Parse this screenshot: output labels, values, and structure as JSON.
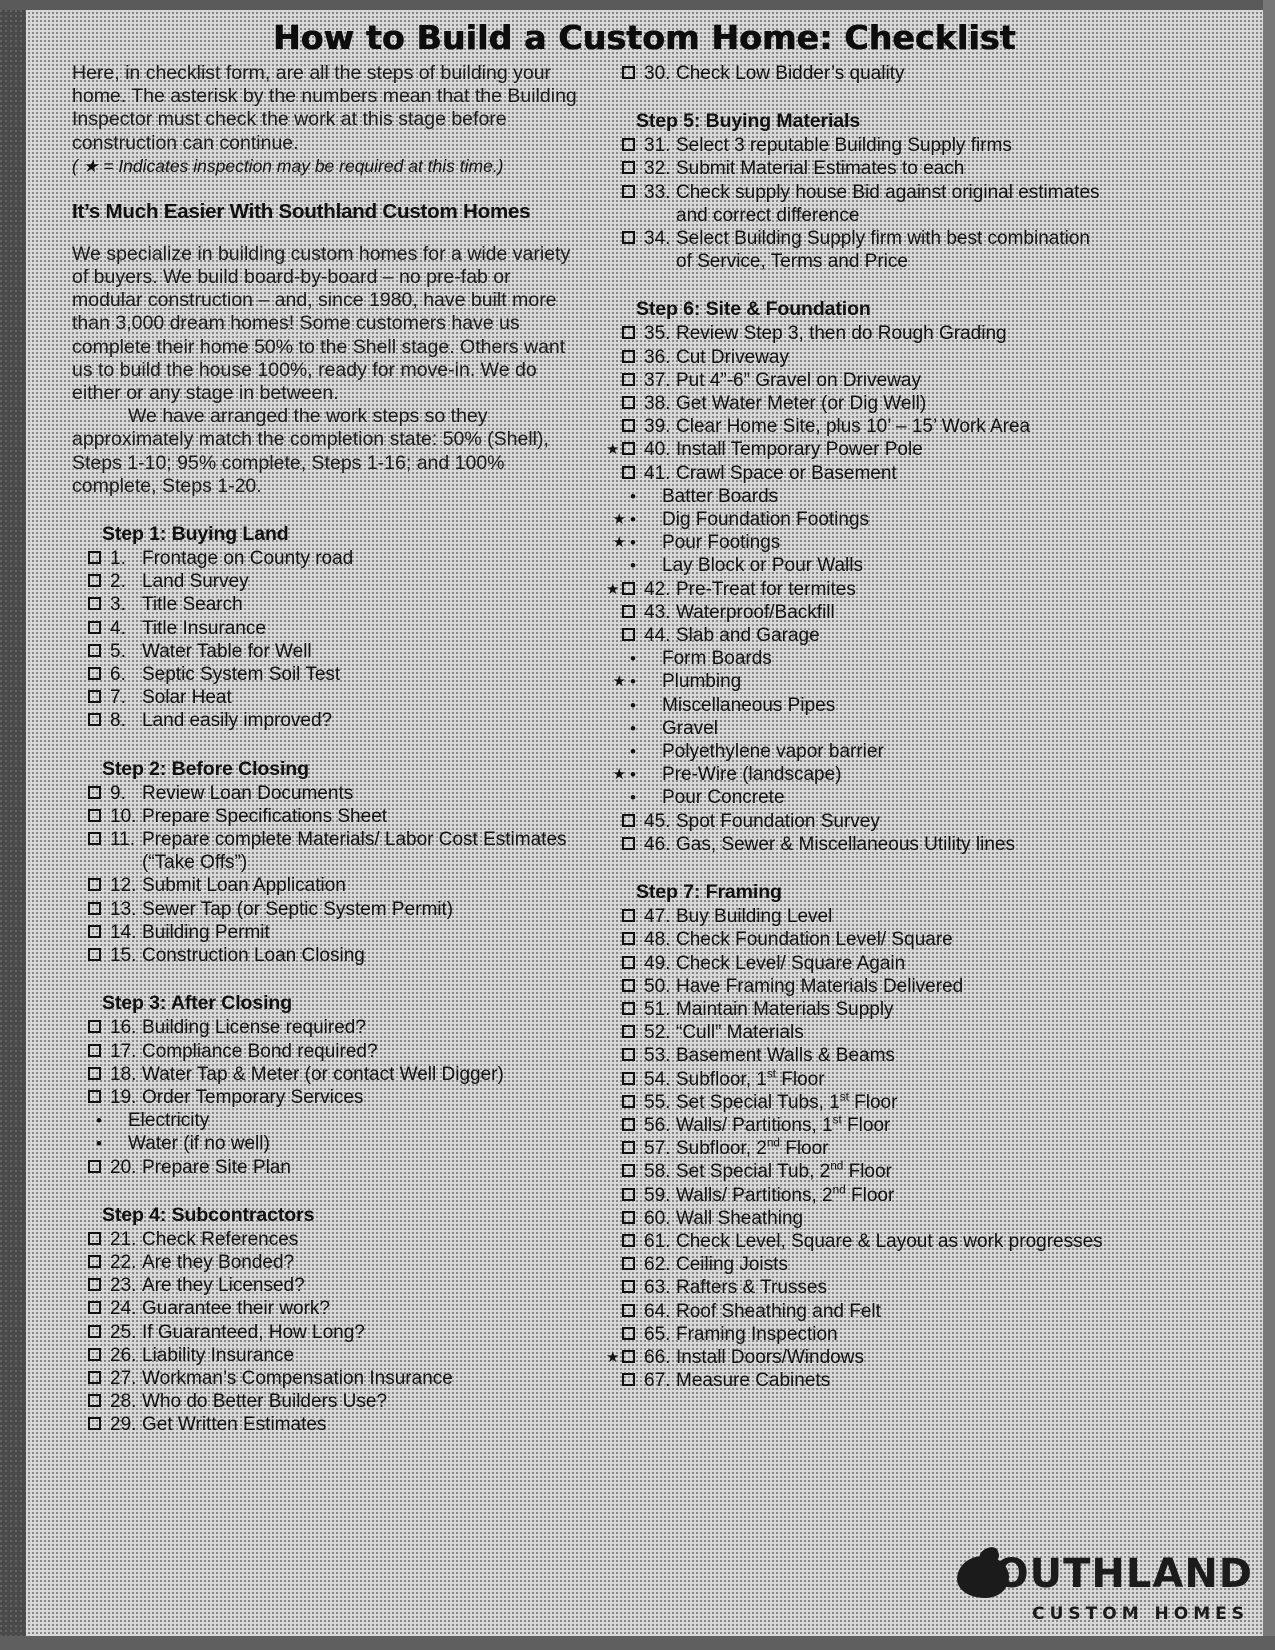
{
  "document": {
    "title": "How to Build a Custom Home: Checklist"
  },
  "intro": {
    "paragraph": "Here, in checklist form, are all the steps of building your home. The asterisk by the numbers mean that the Building Inspector must check the work at this stage before construction can continue.",
    "note": "( ★ = Indicates inspection may be required at this time.)",
    "heading": "It’s Much Easier With Southland Custom Homes",
    "body1": "We specialize in building custom homes for a wide variety of buyers. We build board-by-board – no pre-fab or modular construction – and, since 1980, have built more than 3,000 dream homes! Some customers have us complete their home 50% to the Shell stage. Others want us to build the house 100%, ready for move-in. We do either or any stage in between.",
    "body2": "We have arranged the work steps so they approximately match the completion state: 50% (Shell), Steps 1-10; 95% complete, Steps 1-16; and 100% complete, Steps 1-20."
  },
  "steps": [
    {
      "heading": "Step 1: Buying Land",
      "items": [
        {
          "num": "1.",
          "text": "Frontage on County road"
        },
        {
          "num": "2.",
          "text": "Land Survey"
        },
        {
          "num": "3.",
          "text": "Title Search"
        },
        {
          "num": "4.",
          "text": "Title Insurance"
        },
        {
          "num": "5.",
          "text": "Water Table for Well"
        },
        {
          "num": "6.",
          "text": "Septic System Soil Test"
        },
        {
          "num": "7.",
          "text": "Solar Heat"
        },
        {
          "num": "8.",
          "text": "Land easily improved?"
        }
      ]
    },
    {
      "heading": "Step 2: Before Closing",
      "items": [
        {
          "num": "9.",
          "text": "Review Loan Documents"
        },
        {
          "num": "10.",
          "text": "Prepare Specifications Sheet"
        },
        {
          "num": "11.",
          "text": "Prepare complete Materials/ Labor Cost Estimates",
          "cont": "(“Take Offs”)"
        },
        {
          "num": "12.",
          "text": "Submit Loan Application"
        },
        {
          "num": "13.",
          "text": "Sewer Tap (or Septic System Permit)"
        },
        {
          "num": "14.",
          "text": "Building Permit"
        },
        {
          "num": "15.",
          "text": "Construction Loan Closing"
        }
      ]
    },
    {
      "heading": "Step 3: After Closing",
      "items": [
        {
          "num": "16.",
          "text": "Building License required?"
        },
        {
          "num": "17.",
          "text": "Compliance Bond required?"
        },
        {
          "num": "18.",
          "text": "Water Tap & Meter (or contact Well Digger)"
        },
        {
          "num": "19.",
          "text": "Order Temporary Services",
          "subs": [
            {
              "text": "Electricity"
            },
            {
              "text": "Water (if no well)"
            }
          ]
        },
        {
          "num": "20.",
          "text": "Prepare Site Plan"
        }
      ]
    },
    {
      "heading": "Step 4: Subcontractors",
      "items": [
        {
          "num": "21.",
          "text": "Check References"
        },
        {
          "num": "22.",
          "text": "Are they Bonded?"
        },
        {
          "num": "23.",
          "text": "Are they Licensed?"
        },
        {
          "num": "24.",
          "text": "Guarantee their work?"
        },
        {
          "num": "25.",
          "text": "If Guaranteed, How Long?"
        },
        {
          "num": "26.",
          "text": "Liability Insurance"
        },
        {
          "num": "27.",
          "text": "Workman’s Compensation Insurance"
        },
        {
          "num": "28.",
          "text": "Who do Better Builders Use?"
        },
        {
          "num": "29.",
          "text": "Get Written Estimates"
        },
        {
          "num": "30.",
          "text": "Check Low Bidder’s quality",
          "column": "right"
        }
      ]
    },
    {
      "heading": "Step 5: Buying Materials",
      "items": [
        {
          "num": "31.",
          "text": "Select 3 reputable Building Supply firms"
        },
        {
          "num": "32.",
          "text": "Submit Material Estimates to each"
        },
        {
          "num": "33.",
          "text": "Check supply house Bid against original estimates",
          "cont": "and correct difference"
        },
        {
          "num": "34.",
          "text": "Select Building Supply firm with best combination",
          "cont": "of Service, Terms and Price"
        }
      ]
    },
    {
      "heading": "Step 6: Site & Foundation",
      "items": [
        {
          "num": "35.",
          "text": "Review Step 3, then do Rough Grading"
        },
        {
          "num": "36.",
          "text": "Cut Driveway"
        },
        {
          "num": "37.",
          "text": "Put 4”-6” Gravel on Driveway"
        },
        {
          "num": "38.",
          "text": "Get Water Meter (or Dig Well)"
        },
        {
          "num": "39.",
          "text": "Clear Home Site, plus 10’ – 15’ Work Area"
        },
        {
          "num": "40.",
          "text": "Install Temporary Power Pole",
          "star": true
        },
        {
          "num": "41.",
          "text": "Crawl Space or Basement",
          "subs": [
            {
              "text": "Batter Boards"
            },
            {
              "text": "Dig Foundation Footings",
              "star": true
            },
            {
              "text": "Pour Footings",
              "star": true
            },
            {
              "text": "Lay Block or Pour Walls"
            }
          ]
        },
        {
          "num": "42.",
          "text": "Pre-Treat for termites",
          "star": true
        },
        {
          "num": "43.",
          "text": "Waterproof/Backfill"
        },
        {
          "num": "44.",
          "text": "Slab and Garage",
          "subs": [
            {
              "text": "Form Boards"
            },
            {
              "text": "Plumbing",
              "star": true
            },
            {
              "text": "Miscellaneous Pipes"
            },
            {
              "text": "Gravel"
            },
            {
              "text": "Polyethylene vapor barrier"
            },
            {
              "text": "Pre-Wire (landscape)",
              "star": true
            },
            {
              "text": "Pour Concrete"
            }
          ]
        },
        {
          "num": "45.",
          "text": "Spot Foundation Survey"
        },
        {
          "num": "46.",
          "text": "Gas, Sewer & Miscellaneous Utility lines"
        }
      ]
    },
    {
      "heading": "Step 7: Framing",
      "items": [
        {
          "num": "47.",
          "text": "Buy Building Level"
        },
        {
          "num": "48.",
          "text": "Check Foundation Level/ Square"
        },
        {
          "num": "49.",
          "text": "Check Level/ Square Again"
        },
        {
          "num": "50.",
          "text": "Have Framing Materials Delivered"
        },
        {
          "num": "51.",
          "text": "Maintain Materials Supply"
        },
        {
          "num": "52.",
          "text": "“Cull” Materials"
        },
        {
          "num": "53.",
          "text": "Basement Walls & Beams"
        },
        {
          "num": "54.",
          "text": "Subfloor, 1|st| Floor"
        },
        {
          "num": "55.",
          "text": "Set Special Tubs, 1|st| Floor"
        },
        {
          "num": "56.",
          "text": "Walls/ Partitions, 1|st| Floor"
        },
        {
          "num": "57.",
          "text": "Subfloor, 2|nd| Floor"
        },
        {
          "num": "58.",
          "text": "Set Special Tub, 2|nd| Floor"
        },
        {
          "num": "59.",
          "text": "Walls/ Partitions, 2|nd| Floor"
        },
        {
          "num": "60.",
          "text": "Wall Sheathing"
        },
        {
          "num": "61.",
          "text": "Check Level, Square & Layout as work progresses"
        },
        {
          "num": "62.",
          "text": "Ceiling Joists"
        },
        {
          "num": "63.",
          "text": "Rafters & Trusses"
        },
        {
          "num": "64.",
          "text": "Roof Sheathing and Felt"
        },
        {
          "num": "65.",
          "text": "Framing Inspection"
        },
        {
          "num": "66.",
          "text": "Install Doors/Windows",
          "star": true
        },
        {
          "num": "67.",
          "text": "Measure Cabinets"
        }
      ]
    }
  ],
  "logo": {
    "name": "SOUTHLAND",
    "tagline": "CUSTOM   HOMES"
  },
  "symbols": {
    "star": "★",
    "bullet": "•"
  }
}
